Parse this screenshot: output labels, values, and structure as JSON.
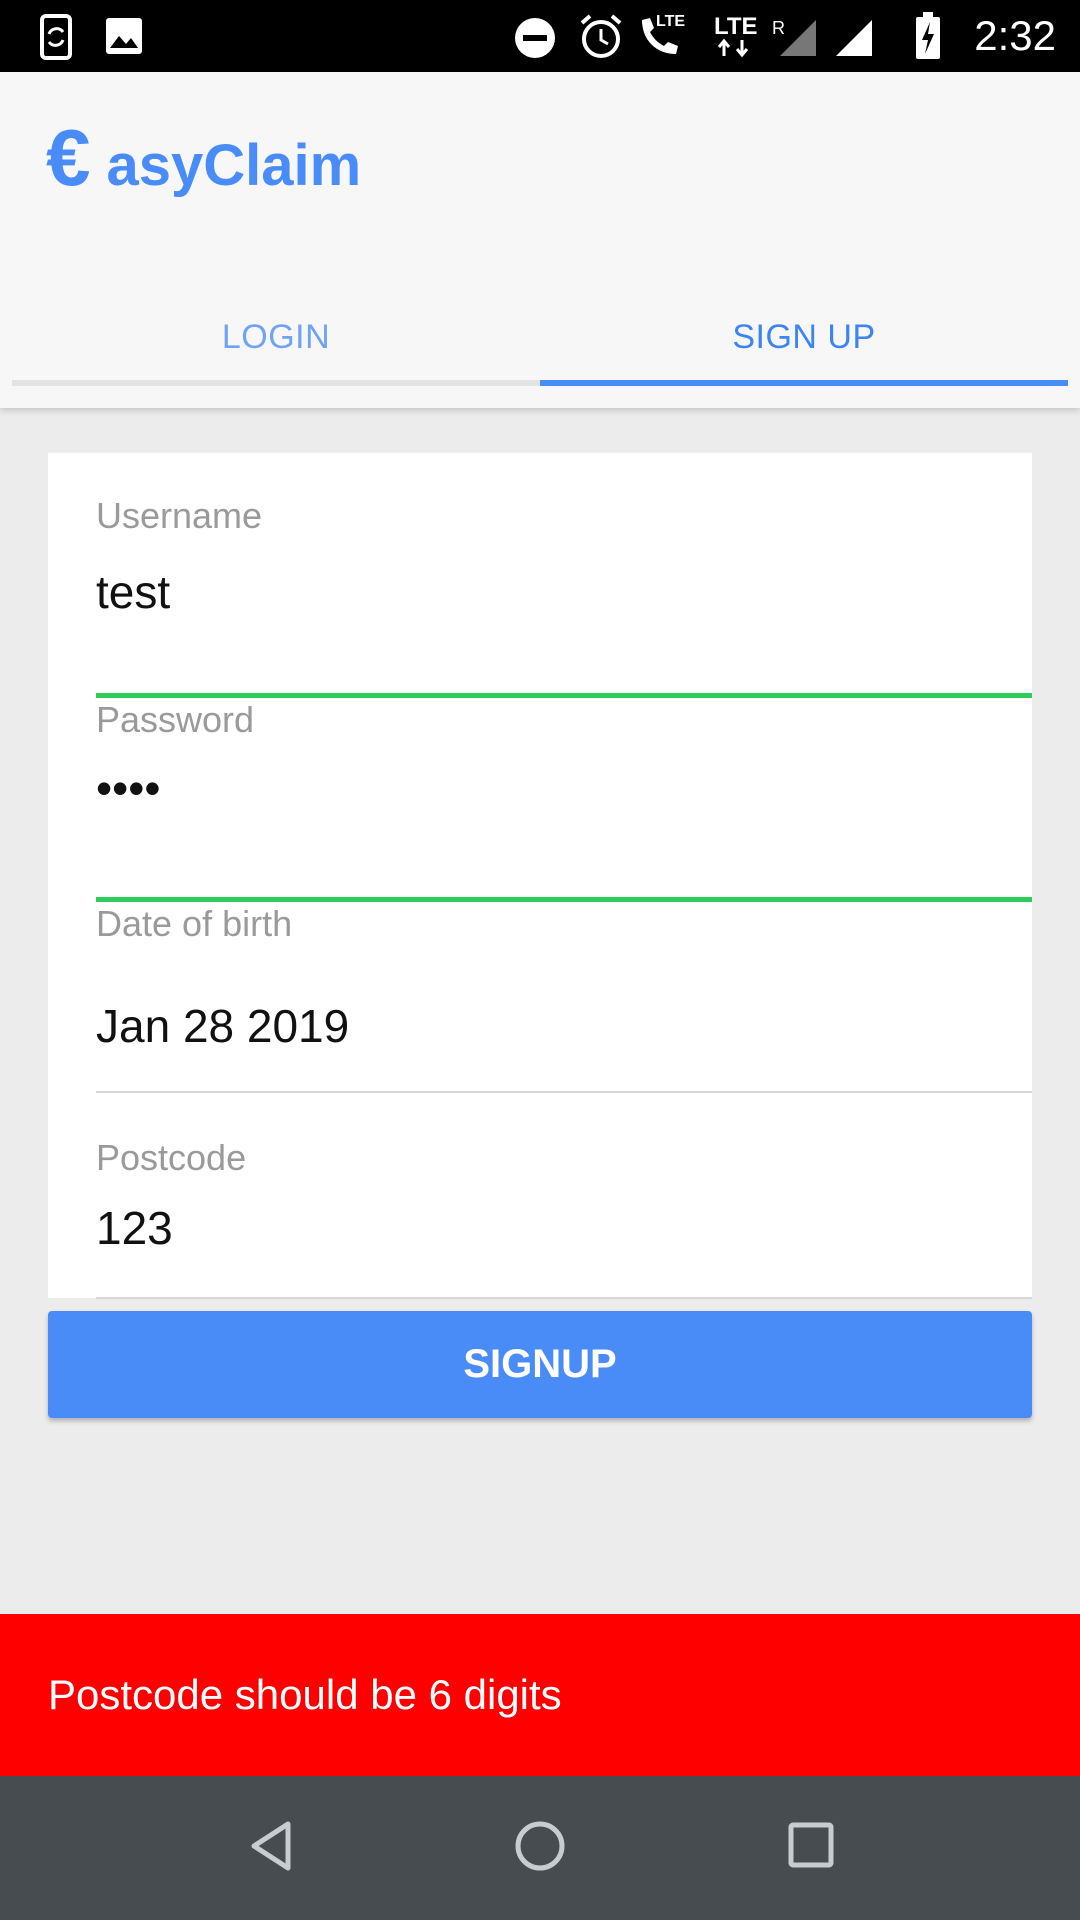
{
  "status_bar": {
    "time": "2:32",
    "icons": [
      "screen-rotate-icon",
      "image-icon",
      "do-not-disturb-icon",
      "alarm-icon",
      "lte-call-icon",
      "lte-data-icon",
      "signal-roaming-icon",
      "signal-icon",
      "battery-charging-icon"
    ],
    "lte_label": "LTE",
    "roaming_label": "R"
  },
  "header": {
    "logo_symbol": "€",
    "app_name": "asyClaim",
    "accent_color": "#4a8cf7"
  },
  "tabs": [
    {
      "label": "LOGIN",
      "active": false
    },
    {
      "label": "SIGN UP",
      "active": true
    }
  ],
  "form": {
    "username": {
      "label": "Username",
      "value": "test"
    },
    "password": {
      "label": "Password",
      "value": "••••"
    },
    "dob": {
      "label": "Date of birth",
      "value": "Jan 28 2019"
    },
    "postcode": {
      "label": "Postcode",
      "value": "123"
    }
  },
  "signup_button": {
    "label": "SIGNUP"
  },
  "toast": {
    "message": "Postcode should be 6 digits",
    "color": "#ff0000"
  },
  "nav_bar": {
    "icons": [
      "back-icon",
      "home-icon",
      "recents-icon"
    ]
  }
}
